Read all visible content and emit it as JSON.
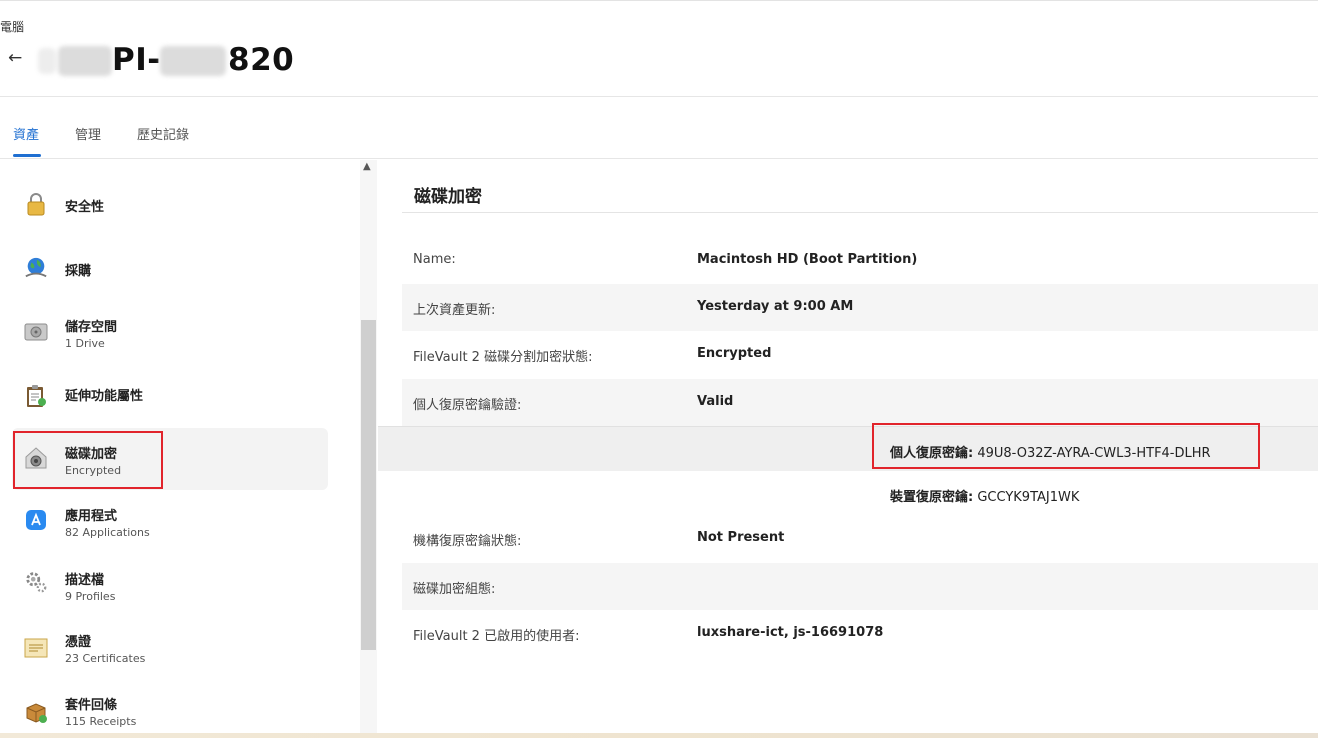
{
  "header": {
    "breadcrumb": "電腦",
    "back_icon": "←",
    "title_visible_fragment_1": "PI-",
    "title_visible_fragment_2": "820"
  },
  "tabs": [
    {
      "label": "資產",
      "active": true
    },
    {
      "label": "管理",
      "active": false
    },
    {
      "label": "歷史記錄",
      "active": false
    }
  ],
  "sidebar": {
    "items": [
      {
        "label": "安全性",
        "sub": "",
        "icon": "lock-icon"
      },
      {
        "label": "採購",
        "sub": "",
        "icon": "globe-icon"
      },
      {
        "label": "儲存空間",
        "sub": "1 Drive",
        "icon": "drive-icon"
      },
      {
        "label": "延伸功能屬性",
        "sub": "",
        "icon": "clipboard-icon"
      },
      {
        "label": "磁碟加密",
        "sub": "Encrypted",
        "icon": "filevault-icon"
      },
      {
        "label": "應用程式",
        "sub": "82 Applications",
        "icon": "app-store-icon"
      },
      {
        "label": "描述檔",
        "sub": "9 Profiles",
        "icon": "gears-icon"
      },
      {
        "label": "憑證",
        "sub": "23 Certificates",
        "icon": "certificate-icon"
      },
      {
        "label": "套件回條",
        "sub": "115 Receipts",
        "icon": "package-icon"
      }
    ]
  },
  "main": {
    "title": "磁碟加密",
    "rows": [
      {
        "label": "Name:",
        "value": "Macintosh HD (Boot Partition)"
      },
      {
        "label": "上次資產更新:",
        "value": "Yesterday at 9:00 AM"
      },
      {
        "label": "FileVault 2 磁碟分割加密狀態:",
        "value": "Encrypted"
      },
      {
        "label": "個人復原密鑰驗證:",
        "value": "Valid"
      }
    ],
    "personal_key_label": "個人復原密鑰:",
    "personal_key_value": "49U8-O32Z-AYRA-CWL3-HTF4-DLHR",
    "device_key_label": "裝置復原密鑰:",
    "device_key_value": "GCCYK9TAJ1WK",
    "rows2": [
      {
        "label": "機構復原密鑰狀態:",
        "value": "Not Present"
      },
      {
        "label": "磁碟加密組態:",
        "value": ""
      },
      {
        "label": "FileVault 2 已啟用的使用者:",
        "value": "luxshare-ict, js-16691078"
      }
    ]
  },
  "colors": {
    "accent": "#1f6fd1",
    "highlight_box": "#e1242b"
  }
}
